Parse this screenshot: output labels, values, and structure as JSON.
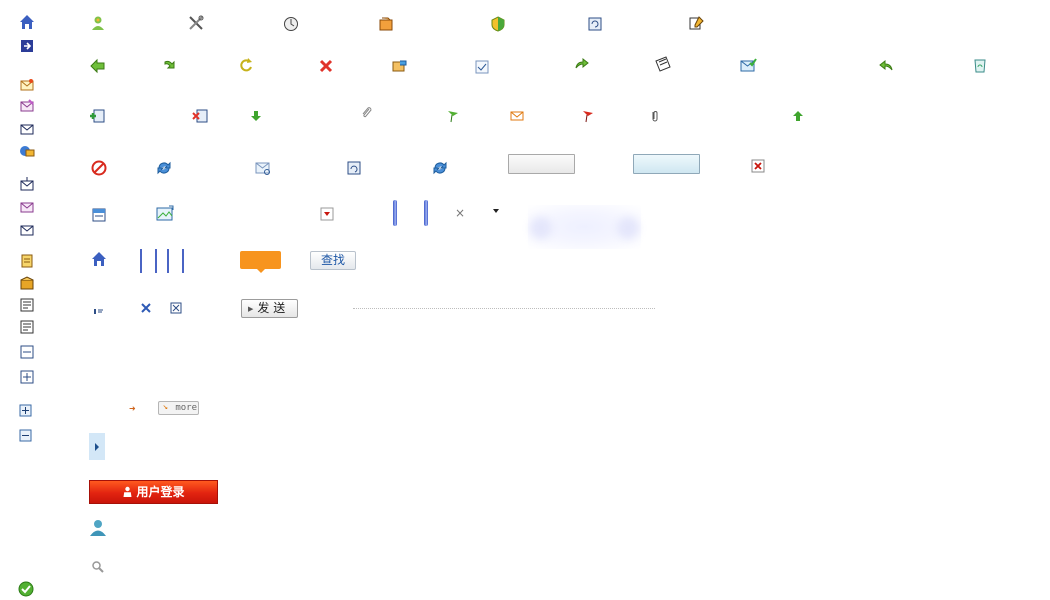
{
  "buttons": {
    "search_label": "查找",
    "send_label": "发 送",
    "more_label": "more",
    "login_label": "用户登录"
  },
  "icons": [
    "home-icon",
    "logout-icon",
    "mail-open-icon",
    "mail-edit-icon",
    "mail-card-icon",
    "contacts-icon",
    "mail-down-icon",
    "mail-attach-icon",
    "mail-box-icon",
    "notes-icon",
    "package-icon",
    "doc-icon",
    "doc-lines-icon",
    "collapse-icon",
    "expand-icon",
    "zoom-in-icon",
    "zoom-out-icon",
    "ok-icon",
    "user-icon",
    "tools-icon",
    "clock-icon",
    "folder-arrow-icon",
    "shield-icon",
    "refresh-doc-icon",
    "edit-note-icon",
    "back-icon",
    "forward-icon",
    "redo-icon",
    "delete-icon",
    "folder-move-icon",
    "check-doc-icon",
    "forward-arrow-icon",
    "write-icon",
    "mail-check-icon",
    "reply-icon",
    "recycle-icon",
    "add-contact-icon",
    "remove-contact-icon",
    "down-arrow-icon",
    "paperclip-icon",
    "flag-green-icon",
    "envelope-icon",
    "flag-red-icon",
    "attach-icon",
    "up-arrow-icon",
    "stop-icon",
    "sync-icon",
    "mail-search-icon",
    "doc-refresh-icon",
    "sync-small-icon",
    "close-red-icon",
    "calendar-icon",
    "picture-icon",
    "dropdown-icon",
    "small-close-icon",
    "sort-icon",
    "x-blue-icon",
    "x-box-icon",
    "user-avatar-icon",
    "search-icon"
  ],
  "colors": {
    "accent_blue": "#3b5fc0",
    "login_red": "#e22410",
    "orange": "#f7941e",
    "search_text": "#1d57a6"
  }
}
